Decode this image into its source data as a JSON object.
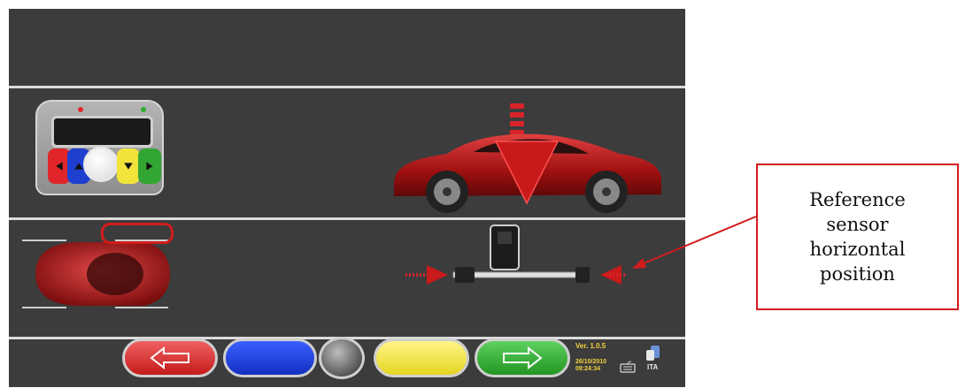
{
  "footer": {
    "version": "Ver. 1.0.5",
    "date": "26/10/2010",
    "time": "09:24:34",
    "language": "ITA"
  },
  "buttons": {
    "back": {
      "icon": "left-arrow-icon",
      "color": "#d42828"
    },
    "blue": {
      "color": "#1a3fd0"
    },
    "center": {
      "color": "#6a6a6a"
    },
    "yellow": {
      "color": "#f0e23a"
    },
    "forward": {
      "icon": "right-arrow-icon",
      "color": "#2fa82e"
    }
  },
  "remote": {
    "buttons": [
      {
        "name": "left",
        "color": "#e0262a"
      },
      {
        "name": "up",
        "color": "#1f3fcf"
      },
      {
        "name": "ok",
        "color": "#ffffff"
      },
      {
        "name": "down",
        "color": "#f2e33a"
      },
      {
        "name": "right",
        "color": "#32a632"
      }
    ],
    "leds": [
      "#e02a2a",
      "#2fae2f"
    ]
  },
  "callout": {
    "text": "Reference\nsensor\nhorizontal\nposition",
    "border_color": "#d21c1c"
  },
  "colors": {
    "screen_bg": "#3c3c3c",
    "accent_red": "#d9232a"
  }
}
